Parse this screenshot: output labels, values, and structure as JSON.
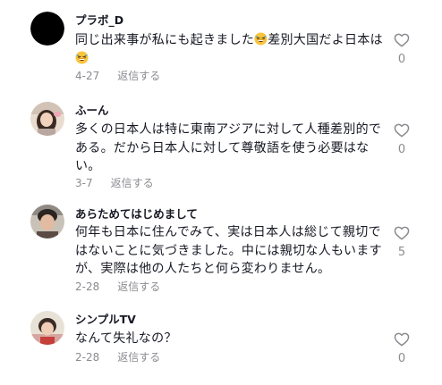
{
  "colors": {
    "text": "#161823",
    "muted": "#8a8b91",
    "heart_outline": "#8a8b91"
  },
  "comments": [
    {
      "username": "プラボ_D",
      "avatar": "black-circle-avatar",
      "text_before_emoji_1": "同じ出来事が私にも起きました",
      "emoji": "grinning-squinting-face",
      "text_after_emoji_1": "差別大国だよ日本は",
      "date": "4-27",
      "reply_label": "返信する",
      "like_count": "0"
    },
    {
      "username": "ふーん",
      "avatar": "photo-avatar",
      "text": "多くの日本人は特に東南アジアに対して人種差別的である。だから日本人に対して尊敬語を使う必要はない。",
      "date": "3-7",
      "reply_label": "返信する",
      "like_count": "0"
    },
    {
      "username": "あらためてはじめまして",
      "avatar": "photo-avatar",
      "text": "何年も日本に住んでみて、実は日本人は総じて親切ではないことに気づきました。中には親切な人もいますが、実際は他の人たちと何ら変わりません。",
      "date": "2-28",
      "reply_label": "返信する",
      "like_count": "5"
    },
    {
      "username": "シンプルTV",
      "avatar": "photo-avatar",
      "text": "なんて失礼なの？",
      "date": "2-28",
      "reply_label": "返信する",
      "like_count": "0"
    }
  ]
}
